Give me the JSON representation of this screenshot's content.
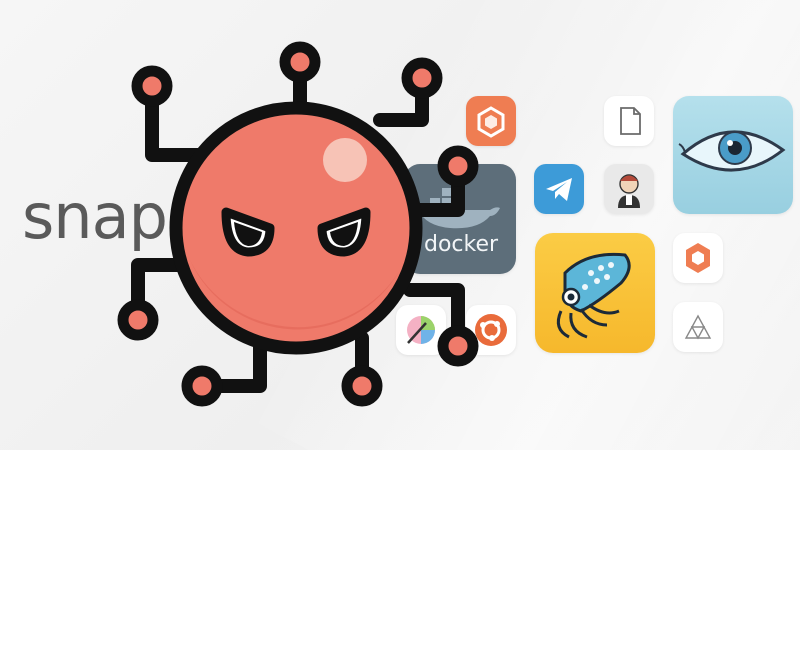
{
  "brand": {
    "wordmark": "snap"
  },
  "tiles": {
    "docker": {
      "label": "docker"
    }
  },
  "colors": {
    "bug_body": "#ef7a6a",
    "bug_outline": "#111111",
    "orange_tile": "#ef7d52",
    "telegram_tile": "#3d9bd8",
    "docker_tile": "#5d6e7a",
    "squid_tile": "#f9c33a",
    "eye_tile": "#a9d8e6"
  },
  "icons": [
    "bug-mascot-icon",
    "cube-icon",
    "file-icon",
    "eye-icon",
    "telegram-icon",
    "jenkins-icon",
    "docker-icon",
    "squid-icon",
    "ubuntu-icon",
    "paint-icon",
    "hexagon-app-icon",
    "sierpinski-icon"
  ]
}
